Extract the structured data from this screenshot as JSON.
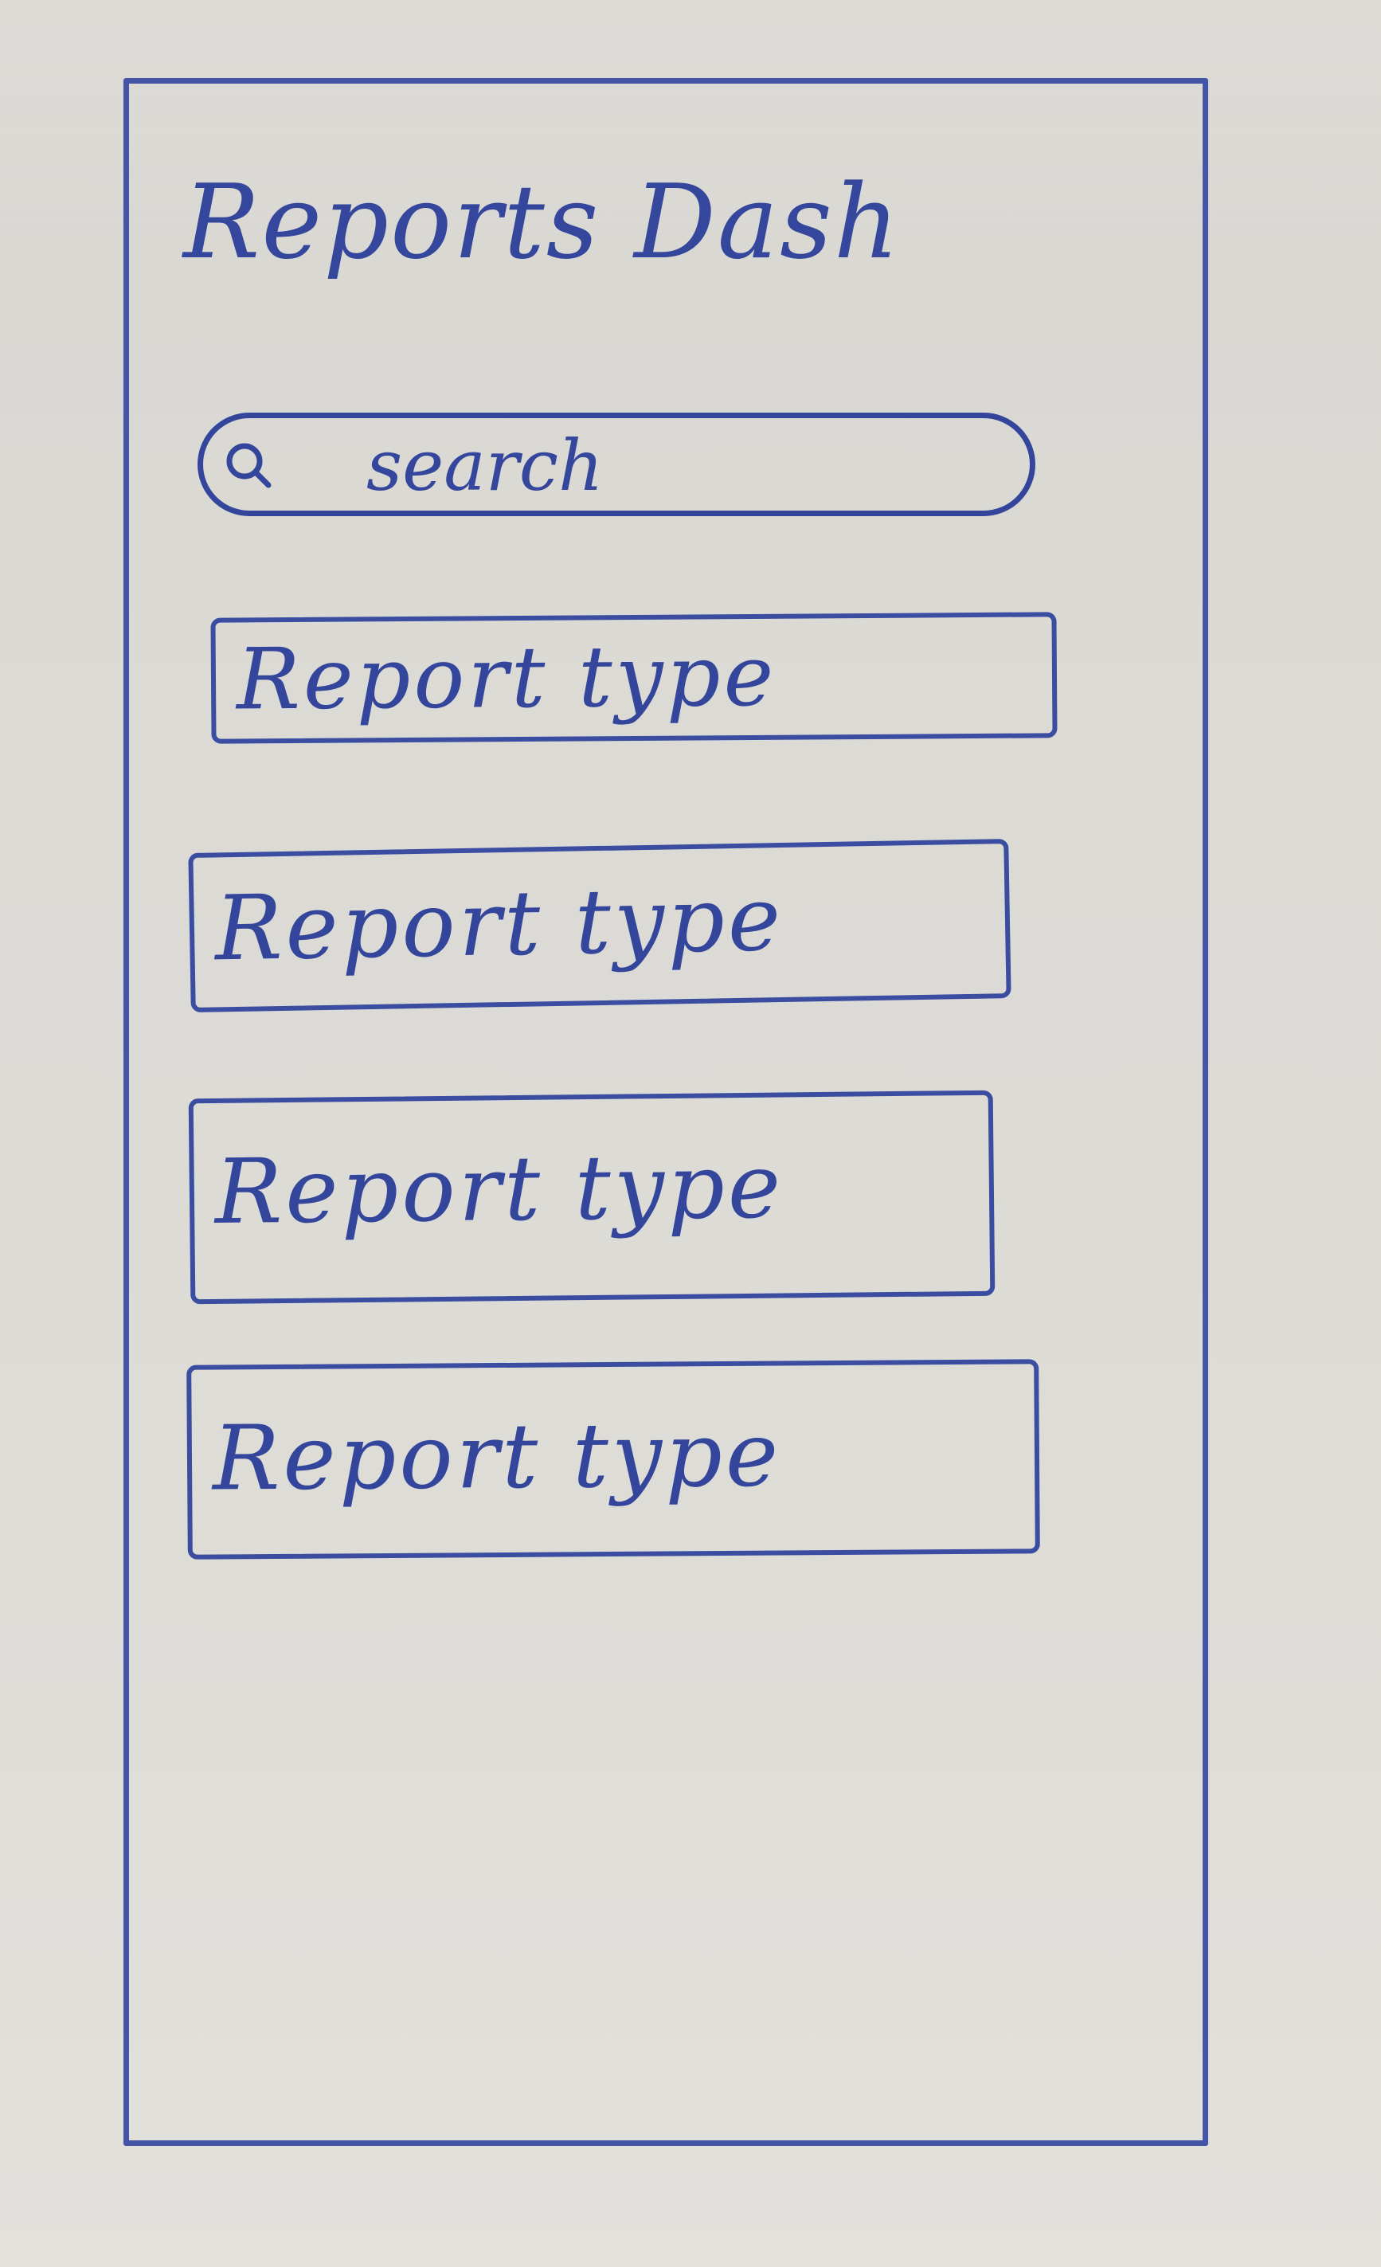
{
  "app": {
    "title": "Reports Dash"
  },
  "search": {
    "icon": "search-icon",
    "placeholder": "search"
  },
  "reports": {
    "items": [
      {
        "label": "Report type"
      },
      {
        "label": "Report type"
      },
      {
        "label": "Report type"
      },
      {
        "label": "Report type"
      }
    ]
  },
  "colors": {
    "ink": "#35479c",
    "paper": "#dcdad5"
  }
}
